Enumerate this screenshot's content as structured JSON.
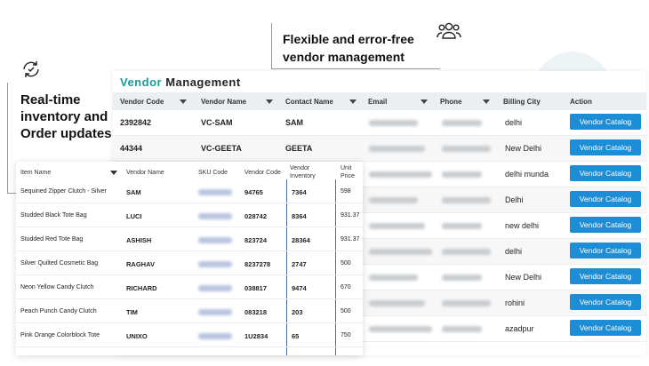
{
  "callouts": {
    "right": "Flexible and error-free vendor management",
    "left": "Real-time inventory and Order updates"
  },
  "vendor_panel": {
    "title_accent": "Vendor",
    "title_rest": " Management",
    "headers": [
      "Vendor Code",
      "Vendor Name",
      "Contact Name",
      "Email",
      "Phone",
      "Billing City",
      "Action"
    ],
    "rows": [
      {
        "code": "2392842",
        "name": "VC-SAM",
        "contact": "SAM",
        "city": "delhi"
      },
      {
        "code": "44344",
        "name": "VC-GEETA",
        "contact": "GEETA",
        "city": "New Delhi"
      },
      {
        "code": "",
        "name": "",
        "contact": "",
        "city": "delhi munda"
      },
      {
        "code": "",
        "name": "",
        "contact": "",
        "city": "Delhi"
      },
      {
        "code": "",
        "name": "",
        "contact": "",
        "city": "new delhi"
      },
      {
        "code": "",
        "name": "",
        "contact": "",
        "city": "delhi"
      },
      {
        "code": "",
        "name": "",
        "contact": "",
        "city": "New Delhi"
      },
      {
        "code": "",
        "name": "",
        "contact": "",
        "city": "rohini"
      },
      {
        "code": "",
        "name": "",
        "contact": "",
        "city": "azadpur"
      }
    ],
    "action_label": "Vendor Catalog"
  },
  "item_panel": {
    "headers": [
      "Item Name",
      "Vendor Name",
      "SKU Code",
      "Vendor Code",
      "Vendor Inventory",
      "Unit Price"
    ],
    "rows": [
      {
        "item": "Sequined Zipper Clutch - Silver",
        "vendor": "SAM",
        "vcode": "94765",
        "inv": "7364",
        "price": "598"
      },
      {
        "item": "Studded Black Tote Bag",
        "vendor": "LUCI",
        "vcode": "028742",
        "inv": "8364",
        "price": "931.37"
      },
      {
        "item": "Studded Red Tote Bag",
        "vendor": "ASHISH",
        "vcode": "823724",
        "inv": "28364",
        "price": "931.37"
      },
      {
        "item": "Silver Quilted Cosmetic Bag",
        "vendor": "RAGHAV",
        "vcode": "8237278",
        "inv": "2747",
        "price": "500"
      },
      {
        "item": "Neon Yellow Candy Clutch",
        "vendor": "RICHARD",
        "vcode": "038817",
        "inv": "9474",
        "price": "670"
      },
      {
        "item": "Peach Punch Candy Clutch",
        "vendor": "TIM",
        "vcode": "083218",
        "inv": "203",
        "price": "500"
      },
      {
        "item": "Pink Orange Colorblock Tote",
        "vendor": "UNIXO",
        "vcode": "1U2834",
        "inv": "65",
        "price": "750"
      }
    ]
  },
  "icons": {
    "people": "people-group-icon",
    "refresh": "refresh-check-icon",
    "filter": "filter-icon"
  },
  "colors": {
    "accent": "#1a9a9a",
    "button": "#1d8ed6",
    "inventory_border": "#4a6fa5"
  }
}
